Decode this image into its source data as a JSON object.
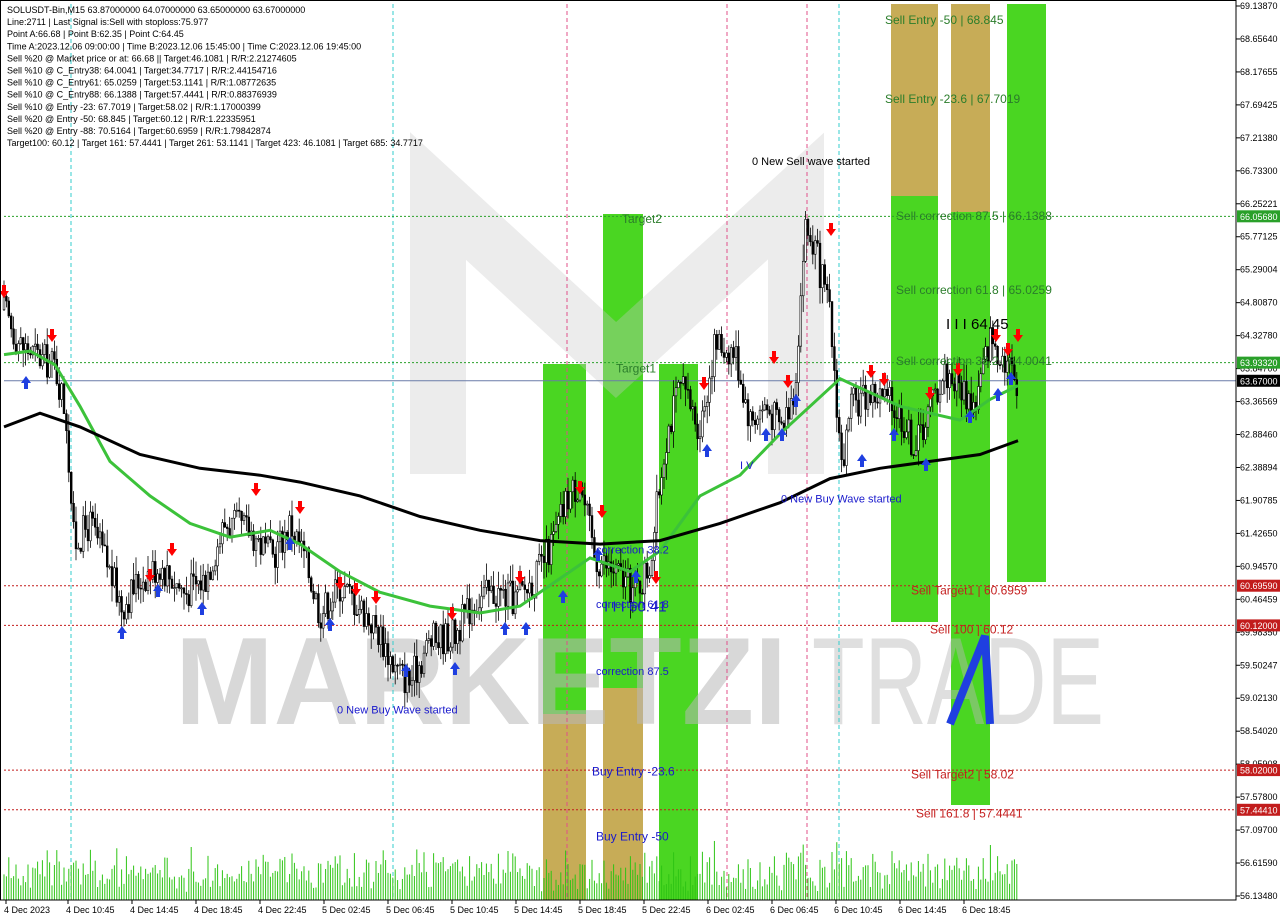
{
  "info": {
    "lines": [
      "SOLUSDT-Bin,M15  63.87000000 64.07000000 63.65000000 63.67000000",
      "Line:2711 | Last Signal is:Sell with stoploss:75.977",
      "Point A:66.68 | Point B:62.35 | Point C:64.45",
      "Time A:2023.12.06 09:00:00 | Time B:2023.12.06 15:45:00 | Time C:2023.12.06 19:45:00",
      "Sell %20 @ Market price or at: 66.68 || Target:46.1081 | R/R:2.21274605",
      "Sell %10 @ C_Entry38: 64.0041 | Target:34.7717 | R/R:2.44154716",
      "Sell %10 @ C_Entry61: 65.0259 | Target:53.1141 | R/R:1.08772635",
      "Sell %10 @ C_Entry88: 66.1388 | Target:57.4441 | R/R:0.88376939",
      "Sell %10 @ Entry -23: 67.7019 | Target:58.02 | R/R:1.17000399",
      "Sell %20 @ Entry -50: 68.845 | Target:60.12 | R/R:1.22335951",
      "Sell %20 @ Entry -88: 70.5164 | Target:60.6959 | R/R:1.79842874",
      "Target100: 60.12 | Target 161: 57.4441 | Target 261: 53.1141 | Target 423: 46.1081 | Target 685: 34.7717"
    ]
  },
  "watermark": {
    "brand_left": "MARKETZI",
    "brand_right": "TRADE"
  },
  "colors": {
    "up_arrow": "#1f3fe0",
    "down_arrow": "#ff0000",
    "green_zone": "#3bd20f",
    "orange_zone": "#f29d6a",
    "ma_fast": "#3cc23a",
    "ma_slow": "#000000",
    "red_level": "#c21c1c",
    "green_level": "#2aa02a",
    "price_tag": "#000000",
    "blue_text": "#1a1acc",
    "red_text": "#c41f1f",
    "green_text": "#2b7d2b"
  },
  "chart_data": {
    "type": "candlestick",
    "symbol": "SOLUSDT-Bin",
    "timeframe": "M15",
    "ohlc_last": {
      "open": 63.87,
      "high": 64.07,
      "low": 63.65,
      "close": 63.67
    },
    "ylim": [
      56.14,
      69.14
    ],
    "y_ticks": [
      "69.13870",
      "68.65640",
      "68.17655",
      "67.69425",
      "67.21380",
      "66.73300",
      "66.25221",
      "65.77125",
      "65.29004",
      "64.80870",
      "64.32780",
      "63.84700",
      "63.36569",
      "62.88460",
      "62.38894",
      "61.90785",
      "61.42650",
      "60.94570",
      "60.46459",
      "59.98350",
      "59.50247",
      "59.02130",
      "58.54020",
      "58.05908",
      "57.57800",
      "57.09700",
      "56.61590",
      "56.13480"
    ],
    "x_ticks": [
      "4 Dec 2023",
      "4 Dec 10:45",
      "4 Dec 14:45",
      "4 Dec 18:45",
      "4 Dec 22:45",
      "5 Dec 02:45",
      "5 Dec 06:45",
      "5 Dec 10:45",
      "5 Dec 14:45",
      "5 Dec 18:45",
      "5 Dec 22:45",
      "6 Dec 02:45",
      "6 Dec 06:45",
      "6 Dec 10:45",
      "6 Dec 14:45",
      "6 Dec 18:45"
    ],
    "price_tags": [
      {
        "label": "66.05680",
        "value": 66.0568,
        "color": "green"
      },
      {
        "label": "63.93320",
        "value": 63.9332,
        "color": "green"
      },
      {
        "label": "63.67000",
        "value": 63.67,
        "color": "black"
      },
      {
        "label": "60.69590",
        "value": 60.6959,
        "color": "red"
      },
      {
        "label": "60.12000",
        "value": 60.12,
        "color": "red"
      },
      {
        "label": "58.02000",
        "value": 58.02,
        "color": "red"
      },
      {
        "label": "57.44410",
        "value": 57.4441,
        "color": "red"
      }
    ],
    "levels": [
      {
        "value": 66.0568,
        "color": "green"
      },
      {
        "value": 63.9332,
        "color": "green"
      },
      {
        "value": 60.6959,
        "color": "red"
      },
      {
        "value": 60.12,
        "color": "red"
      },
      {
        "value": 58.02,
        "color": "red"
      },
      {
        "value": 57.4441,
        "color": "red"
      }
    ],
    "annotations": [
      {
        "text": "Sell Entry -50 | 68.845",
        "color": "green",
        "x_slot": 1,
        "value": 68.845
      },
      {
        "text": "Sell Entry -23.6 | 67.7019",
        "color": "green",
        "x_slot": 1,
        "value": 67.7019
      },
      {
        "text": "0 New Sell wave started",
        "color": "black",
        "x_slot": 0,
        "value": 66.8
      },
      {
        "text": "Sell correction 87.5 | 66.1388",
        "color": "green",
        "x_slot": 2,
        "value": 66.0
      },
      {
        "text": "Target2",
        "color": "green",
        "x_slot": 3,
        "value": 65.96
      },
      {
        "text": "Sell correction 61.8 | 65.0259",
        "color": "green",
        "x_slot": 2,
        "value": 64.93
      },
      {
        "text": "I I I 64.45",
        "color": "black",
        "x_slot": 4,
        "value": 64.42
      },
      {
        "text": "Sell correction 38.2 | 64.0041",
        "color": "green",
        "x_slot": 2,
        "value": 63.9
      },
      {
        "text": "Target1",
        "color": "green",
        "x_slot": 5,
        "value": 63.79
      },
      {
        "text": "0 New Buy Wave started",
        "color": "blue",
        "x_slot": 6,
        "value": 61.9
      },
      {
        "text": "correction 38.2",
        "color": "blue",
        "x_slot": 7,
        "value": 61.16
      },
      {
        "text": "correction 61.8",
        "color": "blue",
        "x_slot": 7,
        "value": 60.37
      },
      {
        "text": "I I I 60.41",
        "color": "blue",
        "x_slot": 8,
        "value": 60.32
      },
      {
        "text": "Sell Target1 | 60.6959",
        "color": "red",
        "x_slot": 9,
        "value": 60.57
      },
      {
        "text": "Sell 100 | 60.12",
        "color": "red",
        "x_slot": 10,
        "value": 60.0
      },
      {
        "text": "correction 87.5",
        "color": "blue",
        "x_slot": 7,
        "value": 59.4
      },
      {
        "text": "0 New Buy Wave started",
        "color": "blue",
        "x_slot": 11,
        "value": 58.84
      },
      {
        "text": "Buy Entry -23.6",
        "color": "blue",
        "x_slot": 12,
        "value": 57.94
      },
      {
        "text": "Sell Target2 | 58.02",
        "color": "red",
        "x_slot": 9,
        "value": 57.9
      },
      {
        "text": "Sell 161.8 | 57.4441",
        "color": "red",
        "x_slot": 13,
        "value": 57.33
      },
      {
        "text": "Buy Entry -50",
        "color": "blue",
        "x_slot": 14,
        "value": 57.0
      },
      {
        "text": "I V",
        "color": "blue",
        "x_slot": 15,
        "value": 62.39
      }
    ]
  }
}
